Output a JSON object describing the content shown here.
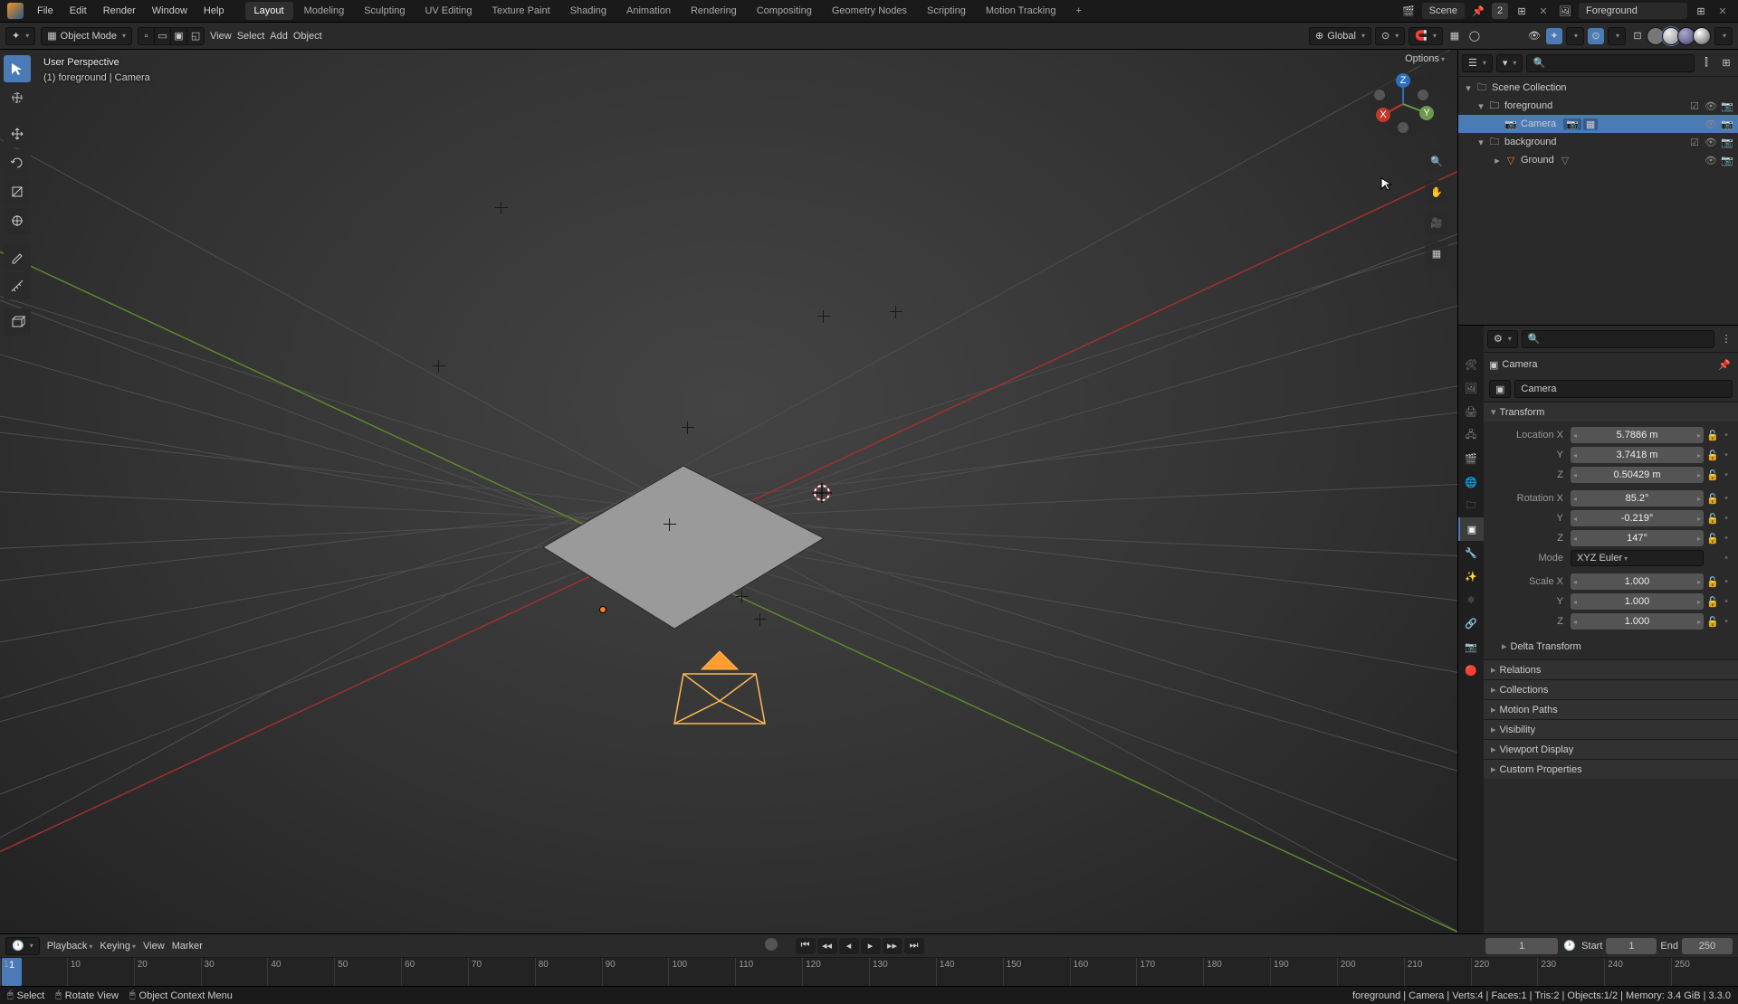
{
  "topmenu": {
    "file": "File",
    "edit": "Edit",
    "render": "Render",
    "window": "Window",
    "help": "Help"
  },
  "workspaces": {
    "layout": "Layout",
    "modeling": "Modeling",
    "sculpting": "Sculpting",
    "uv": "UV Editing",
    "texture": "Texture Paint",
    "shading": "Shading",
    "animation": "Animation",
    "rendering": "Rendering",
    "compositing": "Compositing",
    "geonodes": "Geometry Nodes",
    "scripting": "Scripting",
    "motion": "Motion Tracking"
  },
  "scene": {
    "label": "Scene",
    "badge": "2",
    "layer": "Foreground"
  },
  "header": {
    "mode": "Object Mode",
    "view": "View",
    "select": "Select",
    "add": "Add",
    "object": "Object",
    "orient": "Global",
    "options": "Options"
  },
  "overlay": {
    "persp": "User Perspective",
    "context": "(1) foreground | Camera"
  },
  "outliner": {
    "root": "Scene Collection",
    "fg": "foreground",
    "cam": "Camera",
    "bg": "background",
    "ground": "Ground"
  },
  "props": {
    "crumb": "Camera",
    "name": "Camera",
    "transform": "Transform",
    "locx_l": "Location X",
    "y_l": "Y",
    "z_l": "Z",
    "locx": "5.7886 m",
    "locy": "3.7418 m",
    "locz": "0.50429 m",
    "rotx_l": "Rotation X",
    "rotx": "85.2°",
    "roty": "-0.219°",
    "rotz": "147°",
    "mode_l": "Mode",
    "mode": "XYZ Euler",
    "sclx_l": "Scale X",
    "sclx": "1.000",
    "scly": "1.000",
    "sclz": "1.000",
    "delta": "Delta Transform",
    "relations": "Relations",
    "collections": "Collections",
    "motionpaths": "Motion Paths",
    "visibility": "Visibility",
    "vpdisplay": "Viewport Display",
    "custom": "Custom Properties"
  },
  "timeline": {
    "playback": "Playback",
    "keying": "Keying",
    "view": "View",
    "marker": "Marker",
    "current": "1",
    "start_l": "Start",
    "start": "1",
    "end_l": "End",
    "end": "250",
    "ticks": [
      "1",
      "10",
      "20",
      "30",
      "40",
      "50",
      "60",
      "70",
      "80",
      "90",
      "100",
      "110",
      "120",
      "130",
      "140",
      "150",
      "160",
      "170",
      "180",
      "190",
      "200",
      "210",
      "220",
      "230",
      "240",
      "250"
    ]
  },
  "status": {
    "select": "Select",
    "rotate": "Rotate View",
    "menu": "Object Context Menu",
    "right": "foreground | Camera  |  Verts:4  |  Faces:1  |  Tris:2  |  Objects:1/2  |  Memory: 3.4 GiB  |  3.3.0"
  },
  "gizmo": {
    "x": "X",
    "y": "Y",
    "z": "Z"
  }
}
